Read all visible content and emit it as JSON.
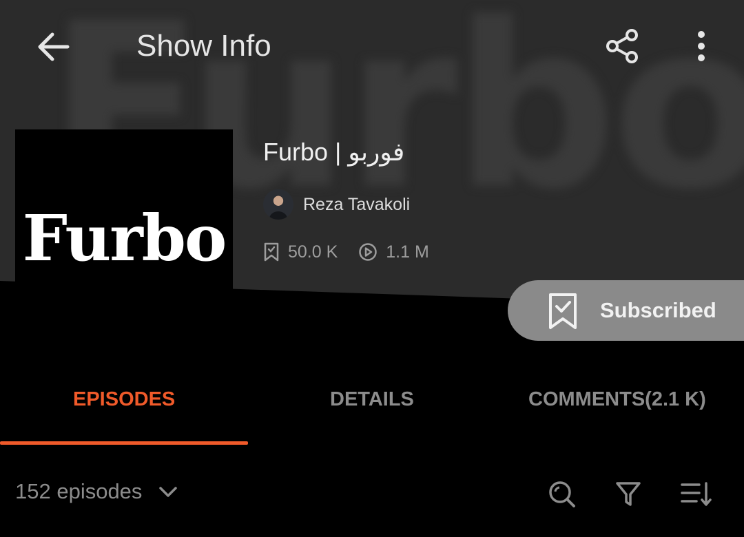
{
  "background": {
    "watermark": "Furbo"
  },
  "topbar": {
    "title": "Show Info"
  },
  "show": {
    "cover_text": "Furbo",
    "title": "Furbo | فوربو",
    "author": "Reza Tavakoli",
    "subscribers": "50.0 K",
    "plays": "1.1 M"
  },
  "subscribe": {
    "label": "Subscribed"
  },
  "tabs": [
    {
      "label": "EPISODES",
      "active": true
    },
    {
      "label": "DETAILS",
      "active": false
    },
    {
      "label": "COMMENTS(2.1 K)",
      "active": false
    }
  ],
  "episodes": {
    "count_label": "152 episodes"
  },
  "colors": {
    "accent": "#f05a2a",
    "header_bg": "#2b2b2b",
    "subscribe_bg": "#8a8a8a",
    "muted_text": "#8c8c8c"
  },
  "icons": [
    "back-arrow-icon",
    "share-icon",
    "more-vertical-icon",
    "bookmark-icon",
    "play-circle-icon",
    "bookmark-check-icon",
    "chevron-down-icon",
    "search-icon",
    "filter-icon",
    "sort-icon"
  ]
}
